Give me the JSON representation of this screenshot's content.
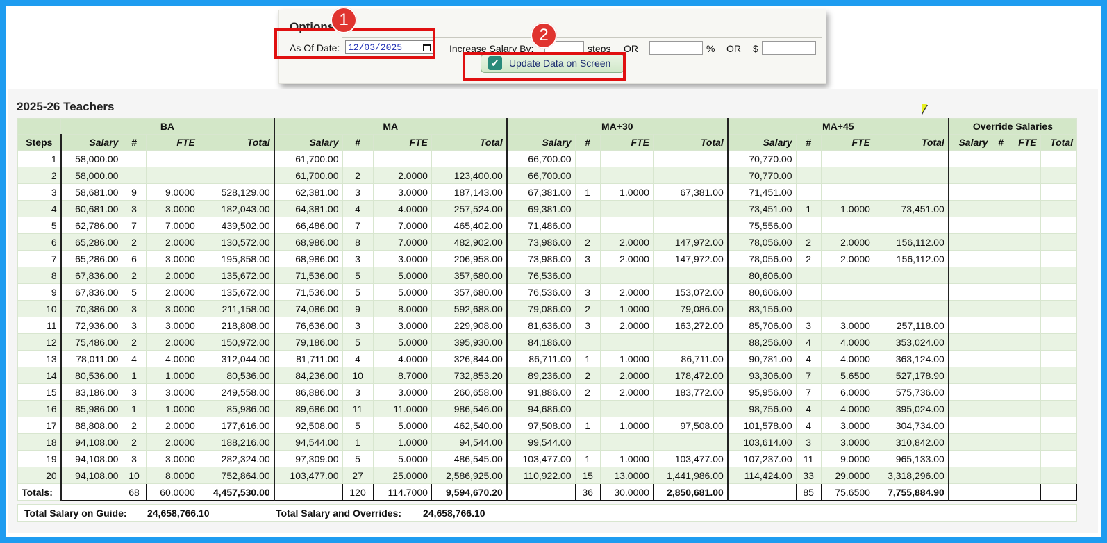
{
  "options": {
    "title": "Options",
    "as_of_label": "As Of Date:",
    "as_of_value": "12/03/2025",
    "increase_label": "Increase Salary By:",
    "steps_label": "steps",
    "or1": "OR",
    "percent": "%",
    "or2": "OR",
    "dollar": "$",
    "update_button": "Update Data on Screen",
    "update_checked": true
  },
  "callouts": {
    "one": "1",
    "two": "2"
  },
  "section_title": "2025-26 Teachers",
  "table": {
    "groups": [
      "BA",
      "MA",
      "MA+30",
      "MA+45",
      "Override Salaries"
    ],
    "steps_header": "Steps",
    "sub_headers": [
      "Salary",
      "#",
      "FTE",
      "Total"
    ],
    "rows": [
      [
        "1",
        "58,000.00",
        "",
        "",
        "",
        "61,700.00",
        "",
        "",
        "",
        "66,700.00",
        "",
        "",
        "",
        "70,770.00",
        "",
        "",
        ""
      ],
      [
        "2",
        "58,000.00",
        "",
        "",
        "",
        "61,700.00",
        "2",
        "2.0000",
        "123,400.00",
        "66,700.00",
        "",
        "",
        "",
        "70,770.00",
        "",
        "",
        ""
      ],
      [
        "3",
        "58,681.00",
        "9",
        "9.0000",
        "528,129.00",
        "62,381.00",
        "3",
        "3.0000",
        "187,143.00",
        "67,381.00",
        "1",
        "1.0000",
        "67,381.00",
        "71,451.00",
        "",
        "",
        ""
      ],
      [
        "4",
        "60,681.00",
        "3",
        "3.0000",
        "182,043.00",
        "64,381.00",
        "4",
        "4.0000",
        "257,524.00",
        "69,381.00",
        "",
        "",
        "",
        "73,451.00",
        "1",
        "1.0000",
        "73,451.00"
      ],
      [
        "5",
        "62,786.00",
        "7",
        "7.0000",
        "439,502.00",
        "66,486.00",
        "7",
        "7.0000",
        "465,402.00",
        "71,486.00",
        "",
        "",
        "",
        "75,556.00",
        "",
        "",
        ""
      ],
      [
        "6",
        "65,286.00",
        "2",
        "2.0000",
        "130,572.00",
        "68,986.00",
        "8",
        "7.0000",
        "482,902.00",
        "73,986.00",
        "2",
        "2.0000",
        "147,972.00",
        "78,056.00",
        "2",
        "2.0000",
        "156,112.00"
      ],
      [
        "7",
        "65,286.00",
        "6",
        "3.0000",
        "195,858.00",
        "68,986.00",
        "3",
        "3.0000",
        "206,958.00",
        "73,986.00",
        "3",
        "2.0000",
        "147,972.00",
        "78,056.00",
        "2",
        "2.0000",
        "156,112.00"
      ],
      [
        "8",
        "67,836.00",
        "2",
        "2.0000",
        "135,672.00",
        "71,536.00",
        "5",
        "5.0000",
        "357,680.00",
        "76,536.00",
        "",
        "",
        "",
        "80,606.00",
        "",
        "",
        ""
      ],
      [
        "9",
        "67,836.00",
        "5",
        "2.0000",
        "135,672.00",
        "71,536.00",
        "5",
        "5.0000",
        "357,680.00",
        "76,536.00",
        "3",
        "2.0000",
        "153,072.00",
        "80,606.00",
        "",
        "",
        ""
      ],
      [
        "10",
        "70,386.00",
        "3",
        "3.0000",
        "211,158.00",
        "74,086.00",
        "9",
        "8.0000",
        "592,688.00",
        "79,086.00",
        "2",
        "1.0000",
        "79,086.00",
        "83,156.00",
        "",
        "",
        ""
      ],
      [
        "11",
        "72,936.00",
        "3",
        "3.0000",
        "218,808.00",
        "76,636.00",
        "3",
        "3.0000",
        "229,908.00",
        "81,636.00",
        "3",
        "2.0000",
        "163,272.00",
        "85,706.00",
        "3",
        "3.0000",
        "257,118.00"
      ],
      [
        "12",
        "75,486.00",
        "2",
        "2.0000",
        "150,972.00",
        "79,186.00",
        "5",
        "5.0000",
        "395,930.00",
        "84,186.00",
        "",
        "",
        "",
        "88,256.00",
        "4",
        "4.0000",
        "353,024.00"
      ],
      [
        "13",
        "78,011.00",
        "4",
        "4.0000",
        "312,044.00",
        "81,711.00",
        "4",
        "4.0000",
        "326,844.00",
        "86,711.00",
        "1",
        "1.0000",
        "86,711.00",
        "90,781.00",
        "4",
        "4.0000",
        "363,124.00"
      ],
      [
        "14",
        "80,536.00",
        "1",
        "1.0000",
        "80,536.00",
        "84,236.00",
        "10",
        "8.7000",
        "732,853.20",
        "89,236.00",
        "2",
        "2.0000",
        "178,472.00",
        "93,306.00",
        "7",
        "5.6500",
        "527,178.90"
      ],
      [
        "15",
        "83,186.00",
        "3",
        "3.0000",
        "249,558.00",
        "86,886.00",
        "3",
        "3.0000",
        "260,658.00",
        "91,886.00",
        "2",
        "2.0000",
        "183,772.00",
        "95,956.00",
        "7",
        "6.0000",
        "575,736.00"
      ],
      [
        "16",
        "85,986.00",
        "1",
        "1.0000",
        "85,986.00",
        "89,686.00",
        "11",
        "11.0000",
        "986,546.00",
        "94,686.00",
        "",
        "",
        "",
        "98,756.00",
        "4",
        "4.0000",
        "395,024.00"
      ],
      [
        "17",
        "88,808.00",
        "2",
        "2.0000",
        "177,616.00",
        "92,508.00",
        "5",
        "5.0000",
        "462,540.00",
        "97,508.00",
        "1",
        "1.0000",
        "97,508.00",
        "101,578.00",
        "4",
        "3.0000",
        "304,734.00"
      ],
      [
        "18",
        "94,108.00",
        "2",
        "2.0000",
        "188,216.00",
        "94,544.00",
        "1",
        "1.0000",
        "94,544.00",
        "99,544.00",
        "",
        "",
        "",
        "103,614.00",
        "3",
        "3.0000",
        "310,842.00"
      ],
      [
        "19",
        "94,108.00",
        "3",
        "3.0000",
        "282,324.00",
        "97,309.00",
        "5",
        "5.0000",
        "486,545.00",
        "103,477.00",
        "1",
        "1.0000",
        "103,477.00",
        "107,237.00",
        "11",
        "9.0000",
        "965,133.00"
      ],
      [
        "20",
        "94,108.00",
        "10",
        "8.0000",
        "752,864.00",
        "103,477.00",
        "27",
        "25.0000",
        "2,586,925.00",
        "110,922.00",
        "15",
        "13.0000",
        "1,441,986.00",
        "114,424.00",
        "33",
        "29.0000",
        "3,318,296.00"
      ]
    ],
    "totals": {
      "label": "Totals:",
      "ba": [
        "68",
        "60.0000",
        "4,457,530.00"
      ],
      "ma": [
        "120",
        "114.7000",
        "9,594,670.20"
      ],
      "ma30": [
        "36",
        "30.0000",
        "2,850,681.00"
      ],
      "ma45": [
        "85",
        "75.6500",
        "7,755,884.90"
      ]
    }
  },
  "footer": {
    "guide_label": "Total Salary on Guide:",
    "guide_value": "24,658,766.10",
    "overrides_label": "Total Salary and Overrides:",
    "overrides_value": "24,658,766.10"
  }
}
